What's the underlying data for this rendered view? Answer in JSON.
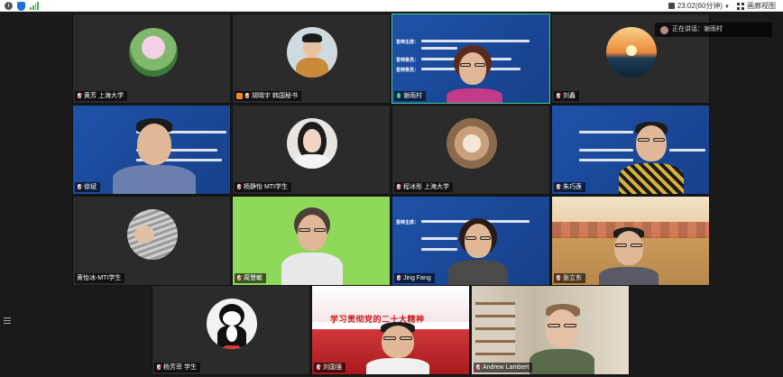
{
  "topbar": {
    "recording": "23:02(60分钟)",
    "gallery": "画廊视图"
  },
  "pip": {
    "label": "正在讲话：谢雨村"
  },
  "participants": [
    {
      "name": "黄芳 上海大学",
      "mic": "off"
    },
    {
      "name": "胡晓宇 韩国秘书",
      "mic": "off",
      "host": true
    },
    {
      "name": "谢雨村",
      "mic": "on",
      "active": true
    },
    {
      "name": "刘鑫",
      "mic": "off"
    },
    {
      "name": "徐斌",
      "mic": "off"
    },
    {
      "name": "杨静怡 MTI学生",
      "mic": "off"
    },
    {
      "name": "程冰彤 上海大学",
      "mic": "off"
    },
    {
      "name": "朱巧莲",
      "mic": "off"
    },
    {
      "name": "黄怡冰-MTI学生",
      "mic": "off"
    },
    {
      "name": "周慧敏",
      "mic": "off"
    },
    {
      "name": "Jing Fang",
      "mic": "off"
    },
    {
      "name": "张立东",
      "mic": "off"
    },
    {
      "name": "杨芳菲 学生",
      "mic": "off"
    },
    {
      "name": "刘国强",
      "mic": "off"
    },
    {
      "name": "Andrew Lambert",
      "mic": "off"
    }
  ],
  "slide": {
    "line1_label": "答辩主席：",
    "line1": "张家骐 河南省社会科学院历史与考古研究所所长、二级研究员",
    "line2_label": "答辩委员：",
    "line2": "张立东 河南大学考古文博系教授",
    "line3_label": "答辩委员：",
    "line3": "Tham Wai Mun 马来亚大学教授"
  },
  "banner": {
    "text": "学习贯彻党的二十大精神"
  },
  "colors": {
    "active_border": "#3ad08a",
    "slide_blue": "#1e52a8",
    "host_badge": "#f08a24"
  }
}
